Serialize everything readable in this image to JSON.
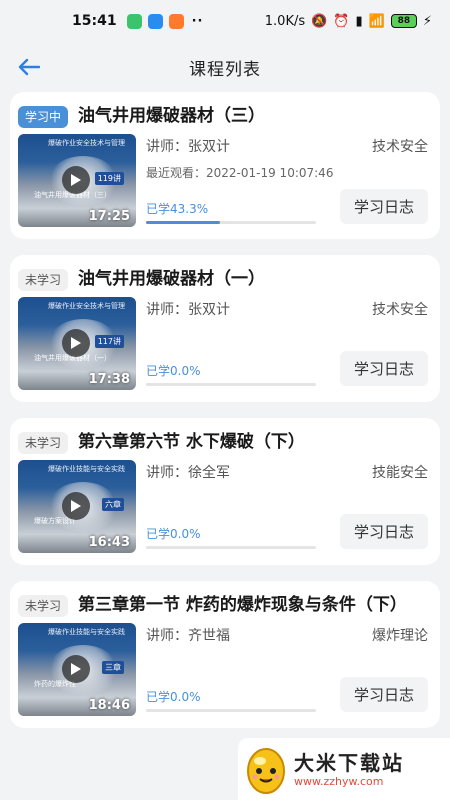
{
  "status_bar": {
    "time": "15:41",
    "net_speed": "1.0K/s",
    "battery": "88"
  },
  "header": {
    "title": "课程列表"
  },
  "courses": [
    {
      "status": "学习中",
      "active": true,
      "title": "油气井用爆破器材（三）",
      "thumb_banner": "爆破作业安全技术与管理",
      "thumb_tag": "119讲",
      "thumb_sub": "油气井用爆破器材（三）",
      "duration": "17:25",
      "teacher": "讲师：张双计",
      "category": "技术安全",
      "recent": "最近观看：2022-01-19 10:07:46",
      "progress_label": "已学43.3%",
      "progress": 43.3,
      "log_label": "学习日志"
    },
    {
      "status": "未学习",
      "active": false,
      "title": "油气井用爆破器材（一）",
      "thumb_banner": "爆破作业安全技术与管理",
      "thumb_tag": "117讲",
      "thumb_sub": "油气井用爆破器材（一）",
      "duration": "17:38",
      "teacher": "讲师：张双计",
      "category": "技术安全",
      "recent": "",
      "progress_label": "已学0.0%",
      "progress": 0,
      "log_label": "学习日志"
    },
    {
      "status": "未学习",
      "active": false,
      "title": "第六章第六节 水下爆破（下）",
      "thumb_banner": "爆破作业技能与安全实践",
      "thumb_tag": "六章",
      "thumb_sub": "爆破方案设计",
      "duration": "16:43",
      "teacher": "讲师：徐全军",
      "category": "技能安全",
      "recent": "",
      "progress_label": "已学0.0%",
      "progress": 0,
      "log_label": "学习日志"
    },
    {
      "status": "未学习",
      "active": false,
      "title": "第三章第一节 炸药的爆炸现象与条件（下）",
      "thumb_banner": "爆破作业技能与安全实践",
      "thumb_tag": "三章",
      "thumb_sub": "炸药的爆炸性",
      "duration": "18:46",
      "teacher": "讲师：齐世福",
      "category": "爆炸理论",
      "recent": "",
      "progress_label": "已学0.0%",
      "progress": 0,
      "log_label": "学习日志"
    }
  ],
  "watermark": {
    "name": "大米下载站",
    "url": "www.zzhyw.com"
  },
  "colors": {
    "accent": "#4a90d9",
    "background": "#f2f3f5",
    "card": "#ffffff"
  }
}
